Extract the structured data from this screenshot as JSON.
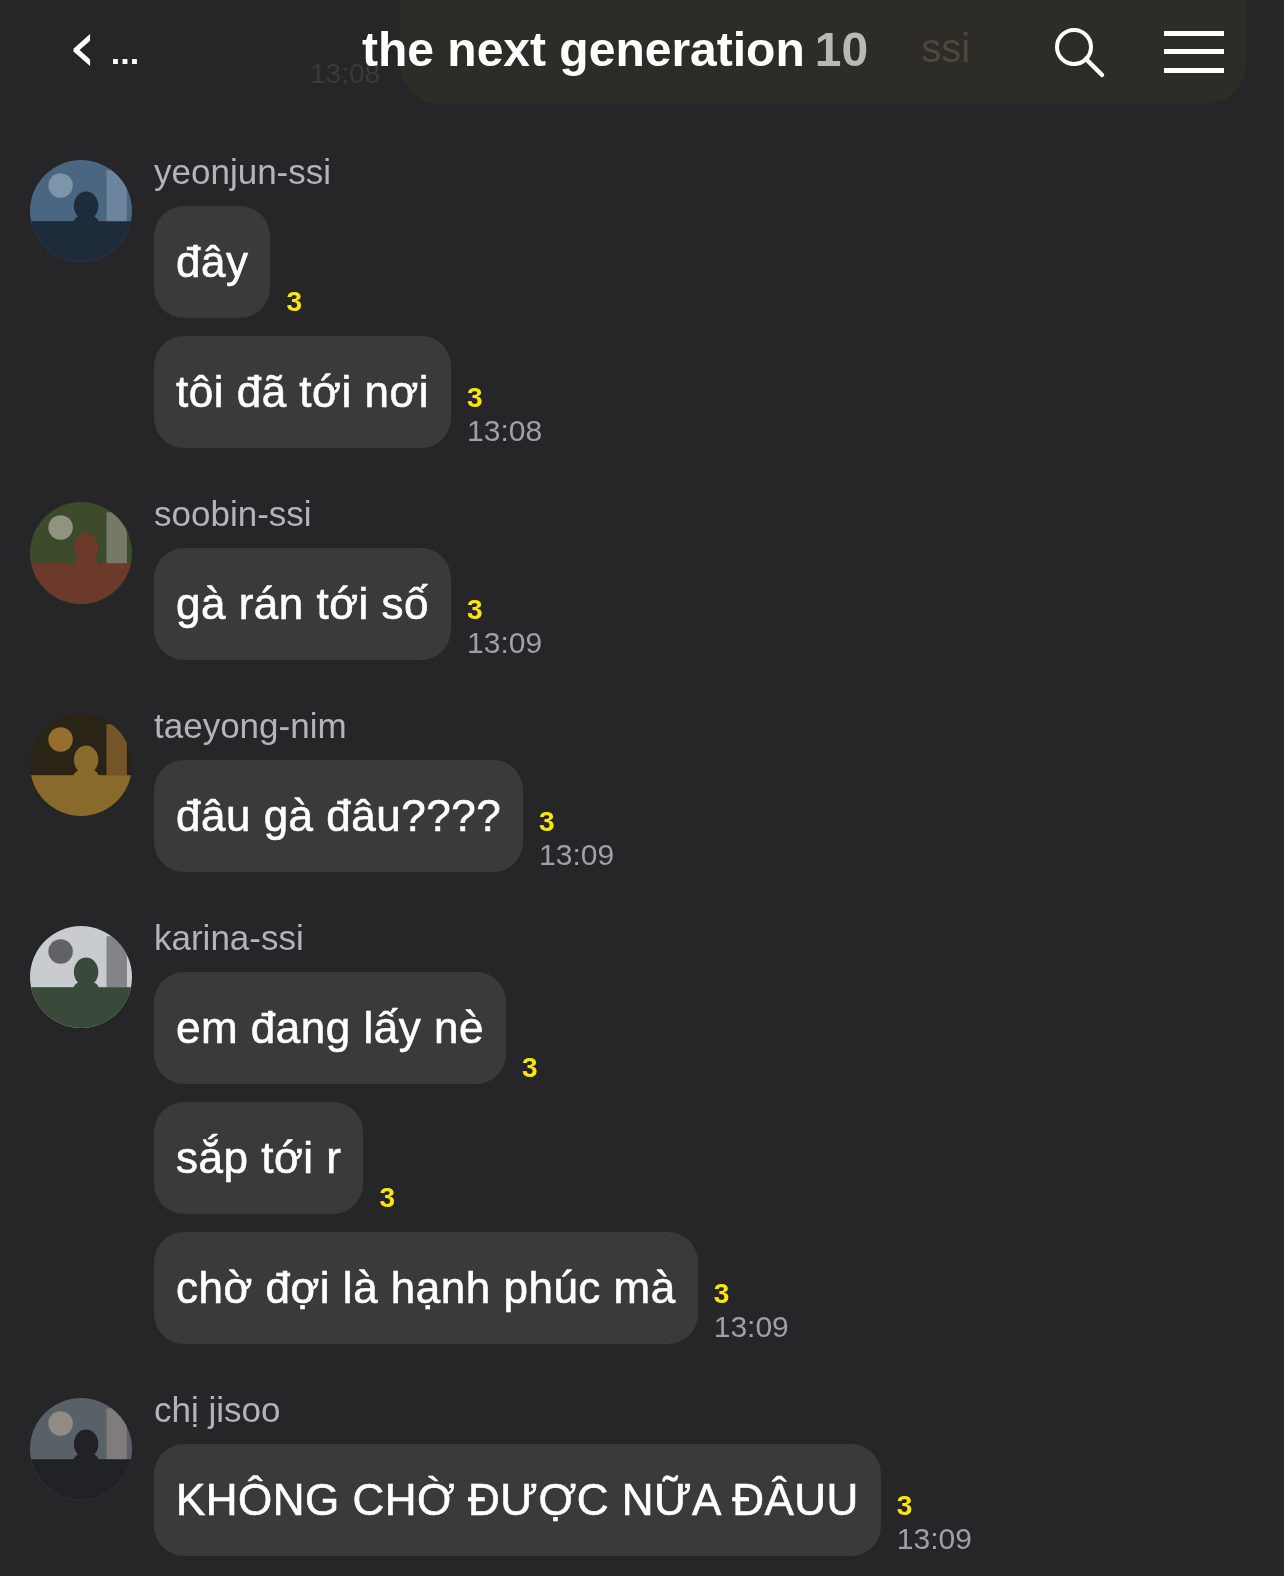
{
  "header": {
    "back": "‹",
    "more": "...",
    "title": "the next generation",
    "count": "10"
  },
  "ghost_message": {
    "text": "ssi",
    "time": "13:08"
  },
  "groups": [
    {
      "name": "yeonjun-ssi",
      "avatar": {
        "kind": "picture"
      },
      "messages": [
        {
          "text": "đây",
          "unread": "3"
        },
        {
          "text": "tôi đã tới nơi",
          "unread": "3",
          "time": "13:08"
        }
      ]
    },
    {
      "name": "soobin-ssi",
      "avatar": {
        "kind": "picture"
      },
      "messages": [
        {
          "text": "gà rán tới số",
          "unread": "3",
          "time": "13:09"
        }
      ]
    },
    {
      "name": "taeyong-nim",
      "avatar": {
        "kind": "picture"
      },
      "messages": [
        {
          "text": "đâu gà đâu????",
          "unread": "3",
          "time": "13:09"
        }
      ]
    },
    {
      "name": "karina-ssi",
      "avatar": {
        "kind": "picture"
      },
      "messages": [
        {
          "text": "em đang lấy nè",
          "unread": "3"
        },
        {
          "text": "sắp tới r",
          "unread": "3"
        },
        {
          "text": "chờ đợi là hạnh phúc mà",
          "unread": "3",
          "time": "13:09"
        }
      ]
    },
    {
      "name": "chị jisoo",
      "avatar": {
        "kind": "picture"
      },
      "messages": [
        {
          "text": "KHÔNG CHỜ ĐƯỢC NỮA ĐÂUU",
          "unread": "3",
          "time": "13:09"
        }
      ]
    }
  ]
}
